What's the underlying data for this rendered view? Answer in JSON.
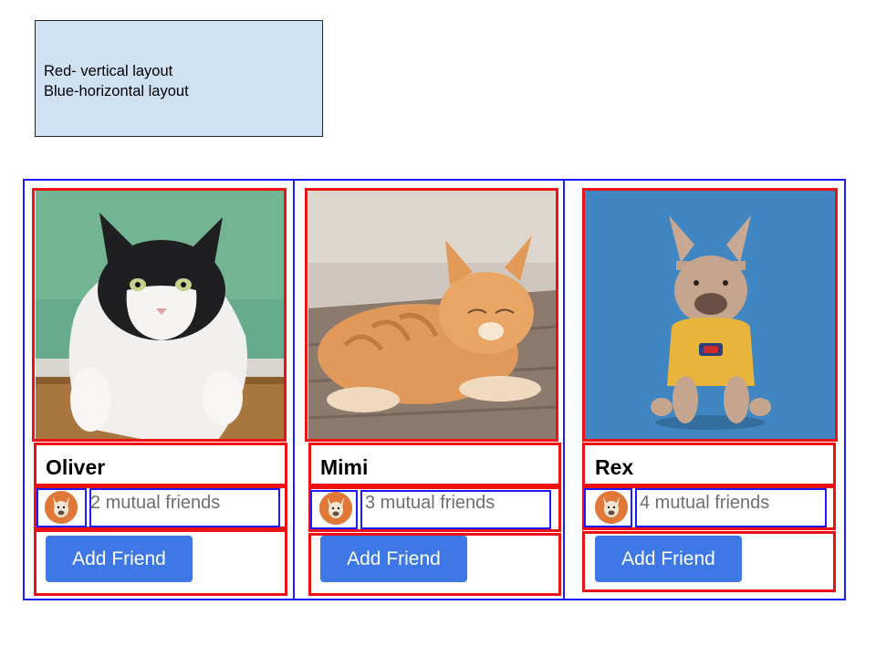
{
  "legend": {
    "line1": "Red- vertical layout",
    "line2": "Blue-horizontal layout"
  },
  "colors": {
    "vertical_layout_outline": "#ee1111",
    "horizontal_layout_outline": "#1a1aff",
    "legend_background": "#cfe2f3",
    "button": "#3e78e6"
  },
  "cards": [
    {
      "name": "Oliver",
      "mutual": "2 mutual friends",
      "button": "Add Friend",
      "photo": "black-and-white cat on green background",
      "avatar": "small dog avatar"
    },
    {
      "name": "Mimi",
      "mutual": "3 mutual friends",
      "button": "Add Friend",
      "photo": "orange tabby cat lying on wooden floor",
      "avatar": "small dog avatar"
    },
    {
      "name": "Rex",
      "mutual": "4 mutual friends",
      "button": "Add Friend",
      "photo": "french bulldog in yellow shirt on blue background",
      "avatar": "small dog avatar"
    }
  ]
}
